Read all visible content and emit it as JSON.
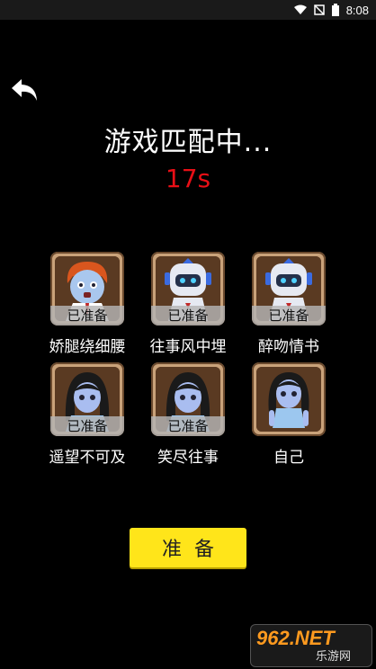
{
  "status_bar": {
    "time": "8:08"
  },
  "back": {
    "icon": "back-arrow-icon"
  },
  "title": "游戏匹配中...",
  "timer": "17s",
  "players": [
    {
      "name": "娇腿绕细腰",
      "status": "已准备",
      "avatar": "red-hair-boy-avatar"
    },
    {
      "name": "往事风中埋",
      "status": "已准备",
      "avatar": "robot-avatar"
    },
    {
      "name": "醉吻情书",
      "status": "已准备",
      "avatar": "robot-avatar"
    },
    {
      "name": "遥望不可及",
      "status": "已准备",
      "avatar": "girl-avatar"
    },
    {
      "name": "笑尽往事",
      "status": "已准备",
      "avatar": "girl-avatar"
    },
    {
      "name": "自己",
      "status": "",
      "avatar": "girl-avatar"
    }
  ],
  "ready_button": "准备",
  "watermark": {
    "main": "962.NET",
    "sub": "乐游网"
  },
  "colors": {
    "timer": "#e80f16",
    "button": "#ffe51a",
    "card_border": "#c9a27a"
  }
}
